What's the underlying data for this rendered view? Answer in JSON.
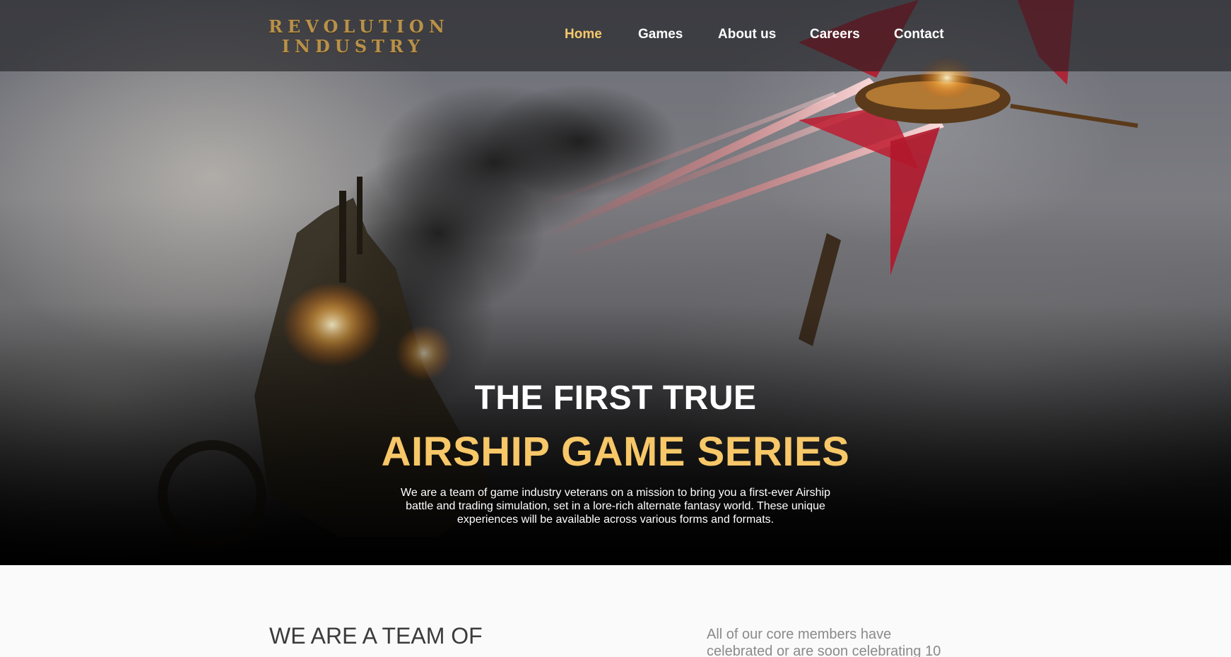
{
  "header": {
    "logo": {
      "line1": "REVOLUTION",
      "line2": "INDUSTRY"
    },
    "nav": [
      {
        "label": "Home",
        "active": true
      },
      {
        "label": "Games",
        "active": false
      },
      {
        "label": "About us",
        "active": false
      },
      {
        "label": "Careers",
        "active": false
      },
      {
        "label": "Contact",
        "active": false
      }
    ]
  },
  "hero": {
    "title_line1": "THE FIRST TRUE",
    "title_line2": "AIRSHIP GAME SERIES",
    "description": "We are a team of game industry veterans on a mission to bring you a first-ever Airship battle and trading simulation, set in a lore-rich alternate fantasy world. These unique experiences will be available across various forms and formats."
  },
  "section": {
    "heading": "WE ARE A TEAM OF",
    "side_text": "All of our core members have celebrated or are soon celebrating 10"
  },
  "colors": {
    "accent": "#f7c768",
    "nav_active": "#f5c96b",
    "logo_gold": "#b8914a",
    "header_bg": "rgba(30,30,34,0.62)"
  }
}
